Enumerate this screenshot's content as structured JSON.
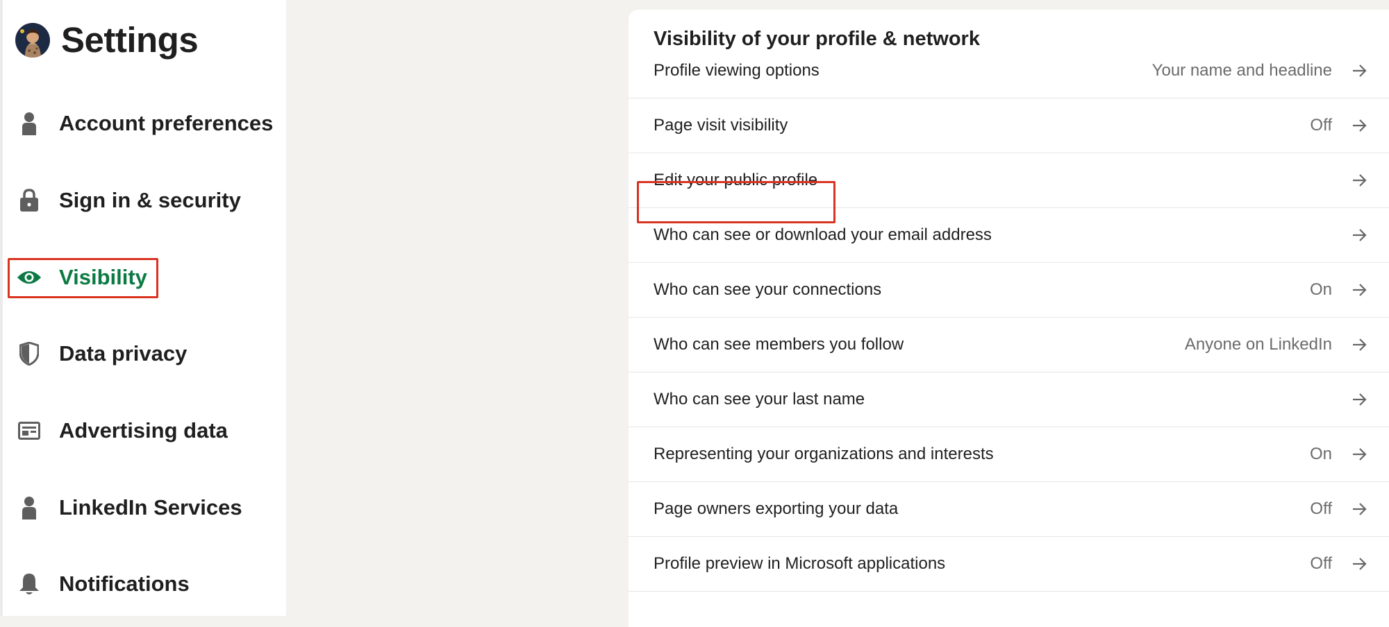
{
  "sidebar": {
    "title": "Settings",
    "items": [
      {
        "label": "Account preferences",
        "icon": "person-icon",
        "active": false
      },
      {
        "label": "Sign in & security",
        "icon": "lock-icon",
        "active": false
      },
      {
        "label": "Visibility",
        "icon": "eye-icon",
        "active": true
      },
      {
        "label": "Data privacy",
        "icon": "shield-icon",
        "active": false
      },
      {
        "label": "Advertising data",
        "icon": "newspaper-icon",
        "active": false
      },
      {
        "label": "LinkedIn Services",
        "icon": "person-icon",
        "active": false
      },
      {
        "label": "Notifications",
        "icon": "bell-icon",
        "active": false
      }
    ]
  },
  "main": {
    "section_title": "Visibility of your profile & network",
    "rows": [
      {
        "label": "Profile viewing options",
        "value": "Your name and headline"
      },
      {
        "label": "Page visit visibility",
        "value": "Off"
      },
      {
        "label": "Edit your public profile",
        "value": ""
      },
      {
        "label": "Who can see or download your email address",
        "value": ""
      },
      {
        "label": "Who can see your connections",
        "value": "On"
      },
      {
        "label": "Who can see members you follow",
        "value": "Anyone on LinkedIn"
      },
      {
        "label": "Who can see your last name",
        "value": ""
      },
      {
        "label": "Representing your organizations and interests",
        "value": "On"
      },
      {
        "label": "Page owners exporting your data",
        "value": "Off"
      },
      {
        "label": "Profile preview in Microsoft applications",
        "value": "Off"
      }
    ]
  },
  "colors": {
    "active_green": "#0b7a43",
    "highlight_red": "#d93320",
    "icon_gray": "#5e5e5e"
  }
}
